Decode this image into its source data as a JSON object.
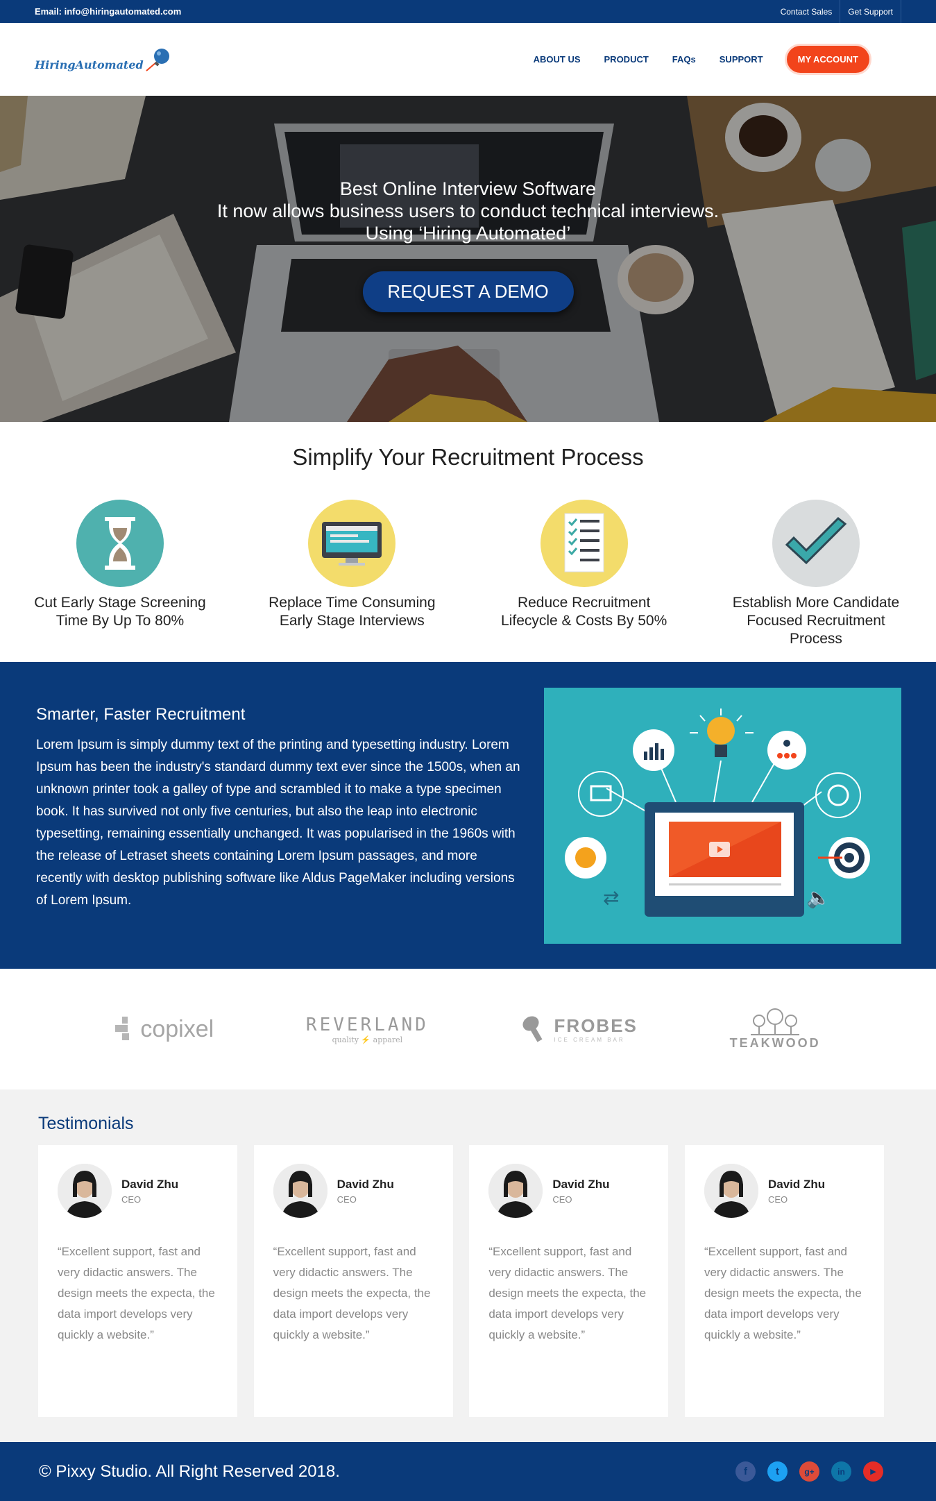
{
  "topbar": {
    "email": "Email: info@hiringautomated.com",
    "contact_sales": "Contact Sales",
    "get_support": "Get Support"
  },
  "header": {
    "logo_text": "HiringAutomated",
    "nav": {
      "about": "ABOUT US",
      "product": "PRODUCT",
      "faqs": "FAQs",
      "support": "SUPPORT",
      "account": "MY ACCOUNT"
    }
  },
  "hero": {
    "line1": "Best Online Interview Software",
    "line2": "It now allows business users to conduct technical interviews.",
    "line3": "Using ‘Hiring Automated’",
    "cta": "REQUEST A DEMO"
  },
  "simplify": {
    "title": "Simplify Your Recruitment Process",
    "features": [
      {
        "label_1": "Cut Early Stage Screening",
        "label_2": "Time By Up To 80%",
        "icon": "hourglass-icon"
      },
      {
        "label_1": "Replace Time Consuming",
        "label_2": "Early Stage Interviews",
        "icon": "monitor-icon"
      },
      {
        "label_1": "Reduce Recruitment",
        "label_2": "Lifecycle & Costs By 50%",
        "icon": "checklist-icon"
      },
      {
        "label_1": "Establish More Candidate",
        "label_2": "Focused Recruitment",
        "label_3": "Process",
        "icon": "checkmark-icon"
      }
    ]
  },
  "smarter": {
    "title": "Smarter, Faster Recruitment",
    "body": "Lorem Ipsum is simply dummy text of the printing and typesetting industry. Lorem Ipsum has been the industry's standard dummy text ever since the 1500s, when an unknown printer took a galley of type and scrambled it to make a type specimen book. It has survived not only five centuries, but also the leap into electronic typesetting, remaining essentially unchanged. It was popularised in the 1960s with the release of Letraset sheets containing Lorem Ipsum passages, and more recently with desktop publishing software like Aldus PageMaker including versions of Lorem Ipsum."
  },
  "brands": {
    "copixel": "copixel",
    "reverland": "REVERLAND",
    "reverland_sub1": "quality",
    "reverland_sub2": "apparel",
    "frobes": "FROBES",
    "frobes_sub": "ICE CREAM BAR",
    "teakwood": "TEAKWOOD"
  },
  "testimonials": {
    "title": "Testimonials",
    "cards": [
      {
        "name": "David Zhu",
        "role": "CEO",
        "quote": "“Excellent support, fast and very didactic answers. The design meets the expecta, the data import develops very quickly a website.”"
      },
      {
        "name": "David Zhu",
        "role": "CEO",
        "quote": "“Excellent support, fast and very didactic answers. The design meets the expecta, the data import develops very quickly a website.”"
      },
      {
        "name": "David Zhu",
        "role": "CEO",
        "quote": "“Excellent support, fast and very didactic answers. The design meets the expecta, the data import develops very quickly a website.”"
      },
      {
        "name": "David Zhu",
        "role": "CEO",
        "quote": "“Excellent support, fast and very didactic answers. The design meets the expecta, the data import develops very quickly a website.”"
      }
    ]
  },
  "footer": {
    "copyright": "© Pixxy Studio. All Right Reserved 2018.",
    "socials": [
      "facebook-icon",
      "twitter-icon",
      "google-plus-icon",
      "linkedin-icon",
      "youtube-icon"
    ]
  },
  "colors": {
    "brand_navy": "#0a3a7a",
    "accent_orange": "#f2441b",
    "teal": "#2fb0bb",
    "yellow": "#f3dc6b"
  }
}
